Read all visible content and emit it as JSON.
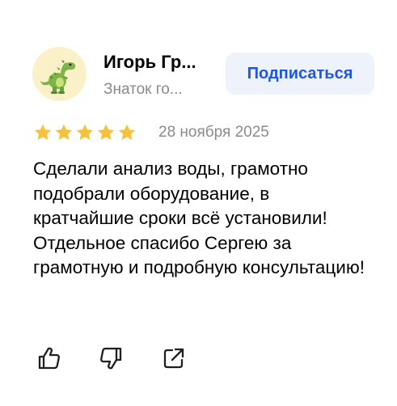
{
  "author": {
    "name": "Игорь Гр...",
    "status": "Знаток го...",
    "avatar_icon": "dinosaur-icon"
  },
  "subscribe_label": "Подписаться",
  "rating": {
    "value": 5,
    "max": 5,
    "color": "#f5c33b"
  },
  "date": "28 ноября 2025",
  "review_text": "Сделали анализ воды, грамотно подобрали оборудование, в кратчайшие сроки всё установили! Отдельное спасибо Сергею за грамотную и подробную консультацию!",
  "actions": [
    {
      "icon": "thumbs-up-icon"
    },
    {
      "icon": "thumbs-down-icon"
    },
    {
      "icon": "share-icon"
    }
  ],
  "colors": {
    "accent": "#1d55e4",
    "muted_text": "#8a8a8a",
    "button_bg": "#eef2fb"
  }
}
